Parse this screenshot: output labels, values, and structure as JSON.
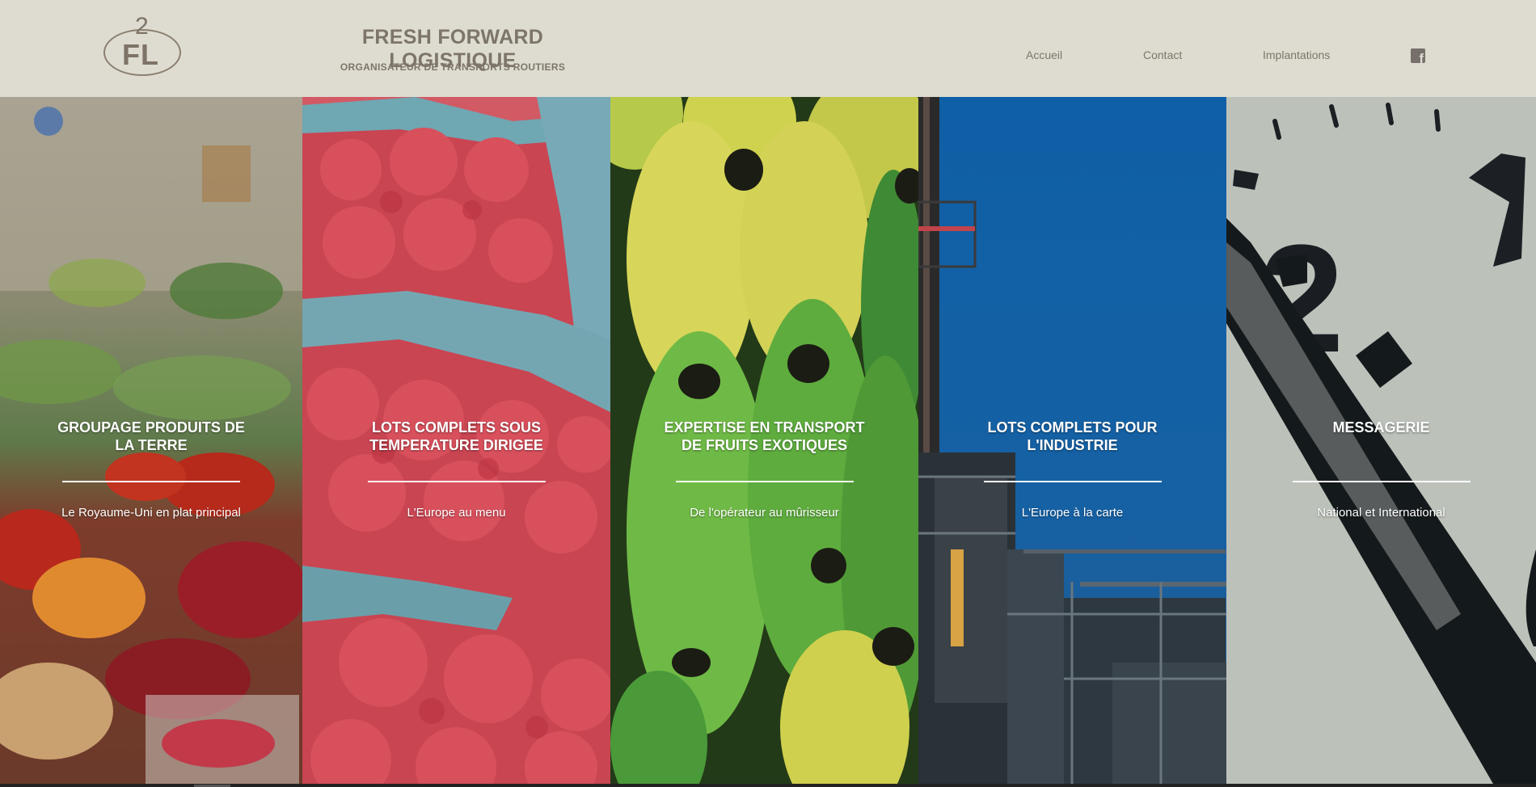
{
  "header": {
    "logo": {
      "top": "2",
      "bottom": "FL"
    },
    "brand_name": "FRESH FORWARD LOGISTIQUE",
    "tagline": "ORGANISATEUR DE TRANSPORTS ROUTIERS",
    "nav": [
      {
        "label": "Accueil"
      },
      {
        "label": "Contact"
      },
      {
        "label": "Implantations"
      }
    ],
    "facebook_icon": "facebook-icon",
    "facebook_glyph": "f"
  },
  "panels": [
    {
      "title": "GROUPAGE PRODUITS DE LA TERRE",
      "subtitle": "Le Royaume-Uni en plat principal",
      "image": "market-produce"
    },
    {
      "title": "LOTS COMPLETS SOUS TEMPERATURE DIRIGEE",
      "subtitle": "L'Europe au menu",
      "image": "raspberries"
    },
    {
      "title": "EXPERTISE EN TRANSPORT DE FRUITS EXOTIQUES",
      "subtitle": "De l'opérateur au mûrisseur",
      "image": "bananas"
    },
    {
      "title": "LOTS COMPLETS POUR L'INDUSTRIE",
      "subtitle": "L'Europe à la carte",
      "image": "industrial-plant"
    },
    {
      "title": "MESSAGERIE",
      "subtitle": "National et International",
      "image": "clock-face"
    }
  ],
  "colors": {
    "header_bg": "#dedcd1",
    "header_text": "#7d7569",
    "panel_text": "#ffffff"
  }
}
